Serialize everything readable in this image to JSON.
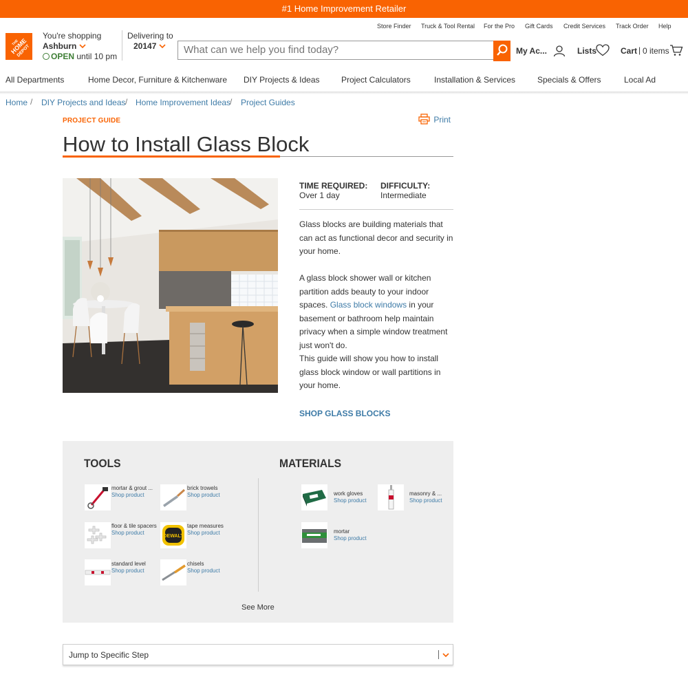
{
  "announcement": "#1 Home Improvement Retailer",
  "utility_links": [
    "Store Finder",
    "Truck & Tool Rental",
    "For the Pro",
    "Gift Cards",
    "Credit Services",
    "Track Order",
    "Help"
  ],
  "logo_text": "THE HOME DEPOT",
  "store": {
    "label": "You're shopping",
    "name": "Ashburn",
    "open": "OPEN",
    "hours": "until 10 pm"
  },
  "delivery": {
    "label": "Delivering to",
    "zip": "20147"
  },
  "search": {
    "placeholder": "What can we help you find today?"
  },
  "account": {
    "my_account": "My Ac...",
    "lists": "Lists",
    "cart": "Cart",
    "cart_count": "0 items"
  },
  "nav": [
    "All Departments",
    "Home Decor, Furniture & Kitchenware",
    "DIY Projects & Ideas",
    "Project Calculators",
    "Installation & Services",
    "Specials & Offers",
    "Local Ad"
  ],
  "breadcrumb": [
    "Home",
    "DIY Projects and Ideas",
    "Home Improvement Ideas",
    "Project Guides"
  ],
  "page": {
    "label": "PROJECT GUIDE",
    "print": "Print",
    "title": "How to Install Glass Block",
    "time_label": "TIME REQUIRED:",
    "time_value": "Over 1 day",
    "difficulty_label": "DIFFICULTY:",
    "difficulty_value": "Intermediate",
    "para1": "Glass blocks are building materials that can act as functional decor and security in your home.",
    "para2_a": "A glass block shower wall or kitchen partition adds beauty to your indoor spaces. ",
    "para2_link": "Glass block windows",
    "para2_b": " in your basement or bathroom help maintain privacy when a simple window treatment just won't do.",
    "para3": "This guide will show you how to install glass block window or wall partitions in your home.",
    "shop_link": "SHOP GLASS BLOCKS"
  },
  "tools": {
    "heading": "TOOLS",
    "items": [
      {
        "name": "mortar & grout ...",
        "link": "Shop product",
        "icon": "mixer-icon"
      },
      {
        "name": "brick trowels",
        "link": "Shop product",
        "icon": "trowel-icon"
      },
      {
        "name": "floor & tile spacers",
        "link": "Shop product",
        "icon": "spacers-icon"
      },
      {
        "name": "tape measures",
        "link": "Shop product",
        "icon": "tape-measure-icon"
      },
      {
        "name": "standard level",
        "link": "Shop product",
        "icon": "level-icon"
      },
      {
        "name": "chisels",
        "link": "Shop product",
        "icon": "chisel-icon"
      }
    ]
  },
  "materials": {
    "heading": "MATERIALS",
    "items": [
      {
        "name": "work gloves",
        "link": "Shop product",
        "icon": "gloves-icon"
      },
      {
        "name": "masonry & ...",
        "link": "Shop product",
        "icon": "caulk-tube-icon"
      },
      {
        "name": "mortar",
        "link": "Shop product",
        "icon": "mortar-bag-icon"
      }
    ]
  },
  "see_more": "See More",
  "jump": "Jump to Specific Step",
  "colors": {
    "brand": "#f96302",
    "link": "#3e7ba7",
    "panel": "#eeeeee"
  }
}
